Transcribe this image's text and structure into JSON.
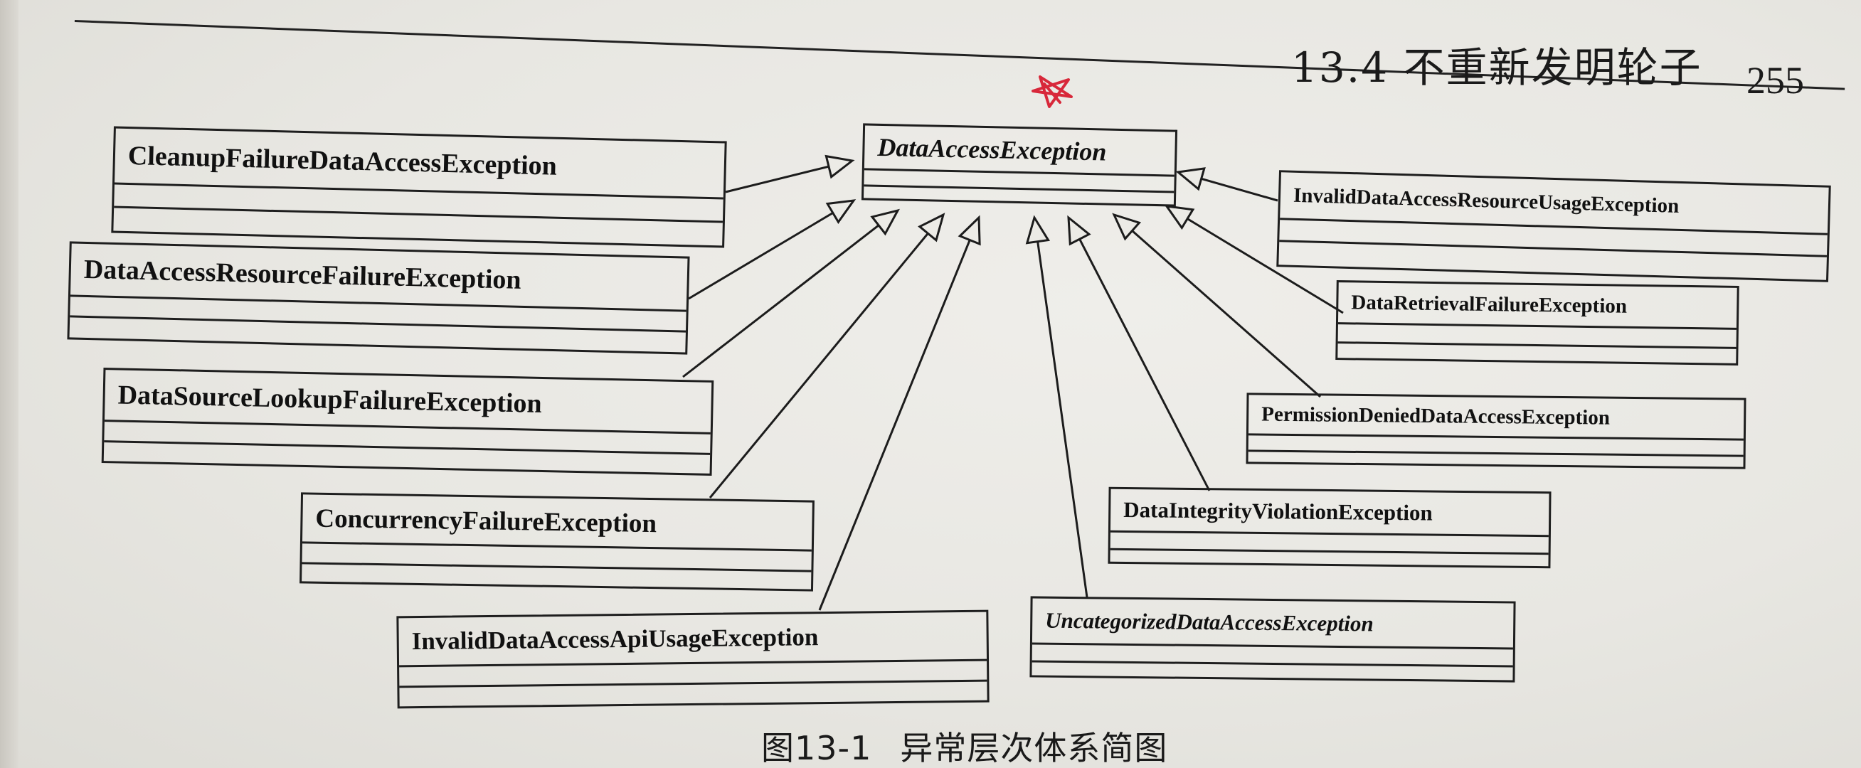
{
  "header": {
    "section_title": "13.4  不重新发明轮子",
    "page_number": "255"
  },
  "diagram": {
    "parent": {
      "name": "DataAccessException",
      "abstract": true
    },
    "subclasses": [
      {
        "id": "cleanup",
        "name": "CleanupFailureDataAccessException",
        "abstract": false
      },
      {
        "id": "resource-failure",
        "name": "DataAccessResourceFailureException",
        "abstract": false
      },
      {
        "id": "datasource-lookup",
        "name": "DataSourceLookupFailureException",
        "abstract": false
      },
      {
        "id": "concurrency",
        "name": "ConcurrencyFailureException",
        "abstract": false
      },
      {
        "id": "api-usage",
        "name": "InvalidDataAccessApiUsageException",
        "abstract": false
      },
      {
        "id": "uncategorized",
        "name": "UncategorizedDataAccessException",
        "abstract": true
      },
      {
        "id": "integrity",
        "name": "DataIntegrityViolationException",
        "abstract": false
      },
      {
        "id": "permission",
        "name": "PermissionDeniedDataAccessException",
        "abstract": false
      },
      {
        "id": "retrieval",
        "name": "DataRetrievalFailureException",
        "abstract": false
      },
      {
        "id": "resource-usage",
        "name": "InvalidDataAccessResourceUsageException",
        "abstract": false
      }
    ],
    "annotation_color": "#d8283a"
  },
  "caption": {
    "figure_label": "图13-1",
    "figure_title": "异常层次体系简图"
  }
}
